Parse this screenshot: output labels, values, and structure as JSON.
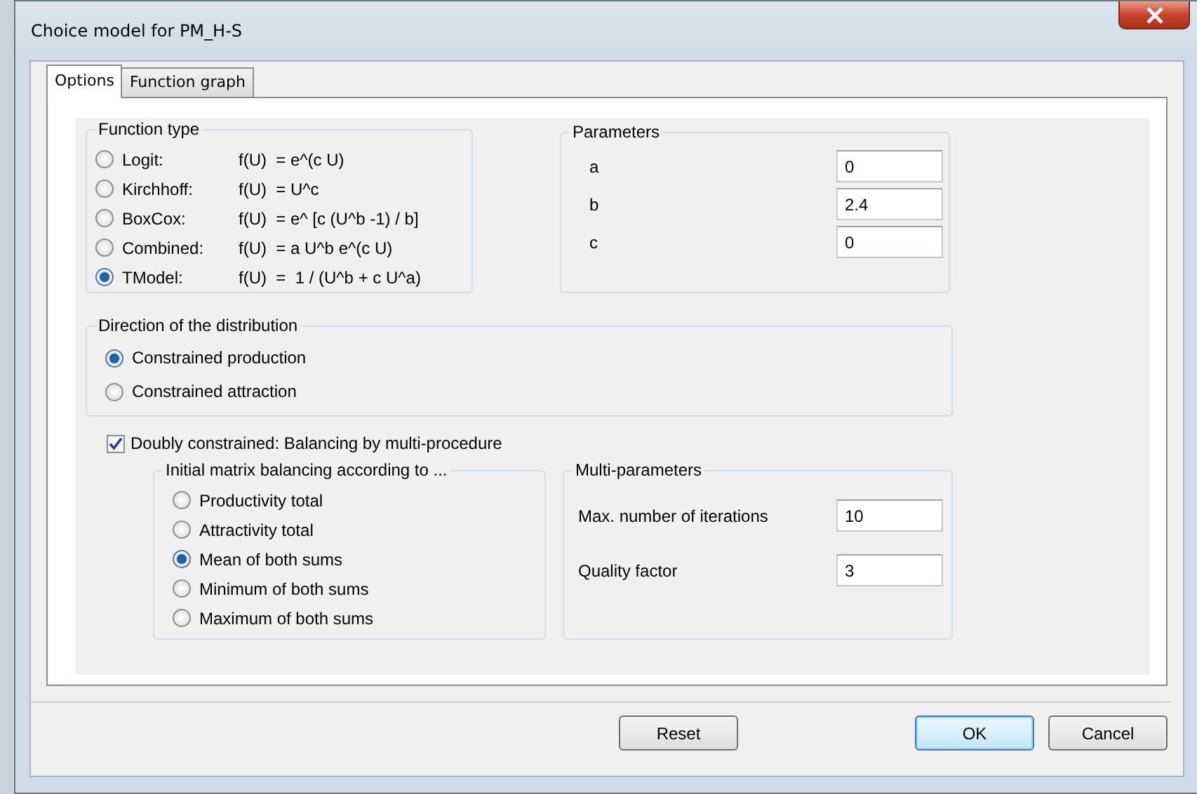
{
  "window": {
    "title": "Choice model for PM_H-S"
  },
  "tabs": [
    {
      "label": "Options",
      "selected": true
    },
    {
      "label": "Function graph",
      "selected": false
    }
  ],
  "function_type": {
    "title": "Function type",
    "options": [
      {
        "label": "Logit:",
        "formula": "f(U)  = e^(c U)",
        "selected": false
      },
      {
        "label": "Kirchhoff:",
        "formula": "f(U)  = U^c",
        "selected": false
      },
      {
        "label": "BoxCox:",
        "formula": "f(U)  = e^ [c (U^b -1) / b]",
        "selected": false
      },
      {
        "label": "Combined:",
        "formula": "f(U)  = a U^b e^(c U)",
        "selected": false
      },
      {
        "label": "TModel:",
        "formula": "f(U)  =  1 / (U^b + c U^a)",
        "selected": true
      }
    ]
  },
  "parameters": {
    "title": "Parameters",
    "fields": [
      {
        "label": "a",
        "value": "0"
      },
      {
        "label": "b",
        "value": "2.4"
      },
      {
        "label": "c",
        "value": "0"
      }
    ]
  },
  "direction": {
    "title": "Direction of the distribution",
    "options": [
      {
        "label": "Constrained production",
        "selected": true
      },
      {
        "label": "Constrained attraction",
        "selected": false
      }
    ]
  },
  "doubly_constrained": {
    "label": "Doubly constrained: Balancing by multi-procedure",
    "checked": true
  },
  "initial_balancing": {
    "title": "Initial matrix balancing according to ...",
    "options": [
      {
        "label": "Productivity total",
        "selected": false
      },
      {
        "label": "Attractivity total",
        "selected": false
      },
      {
        "label": "Mean of both sums",
        "selected": true
      },
      {
        "label": "Minimum of both sums",
        "selected": false
      },
      {
        "label": "Maximum of both sums",
        "selected": false
      }
    ]
  },
  "multi_parameters": {
    "title": "Multi-parameters",
    "fields": [
      {
        "label": "Max. number of iterations",
        "value": "10"
      },
      {
        "label": "Quality factor",
        "value": "3"
      }
    ]
  },
  "buttons": [
    {
      "label": "Reset",
      "default": false
    },
    {
      "label": "OK",
      "default": true
    },
    {
      "label": "Cancel",
      "default": false
    }
  ]
}
